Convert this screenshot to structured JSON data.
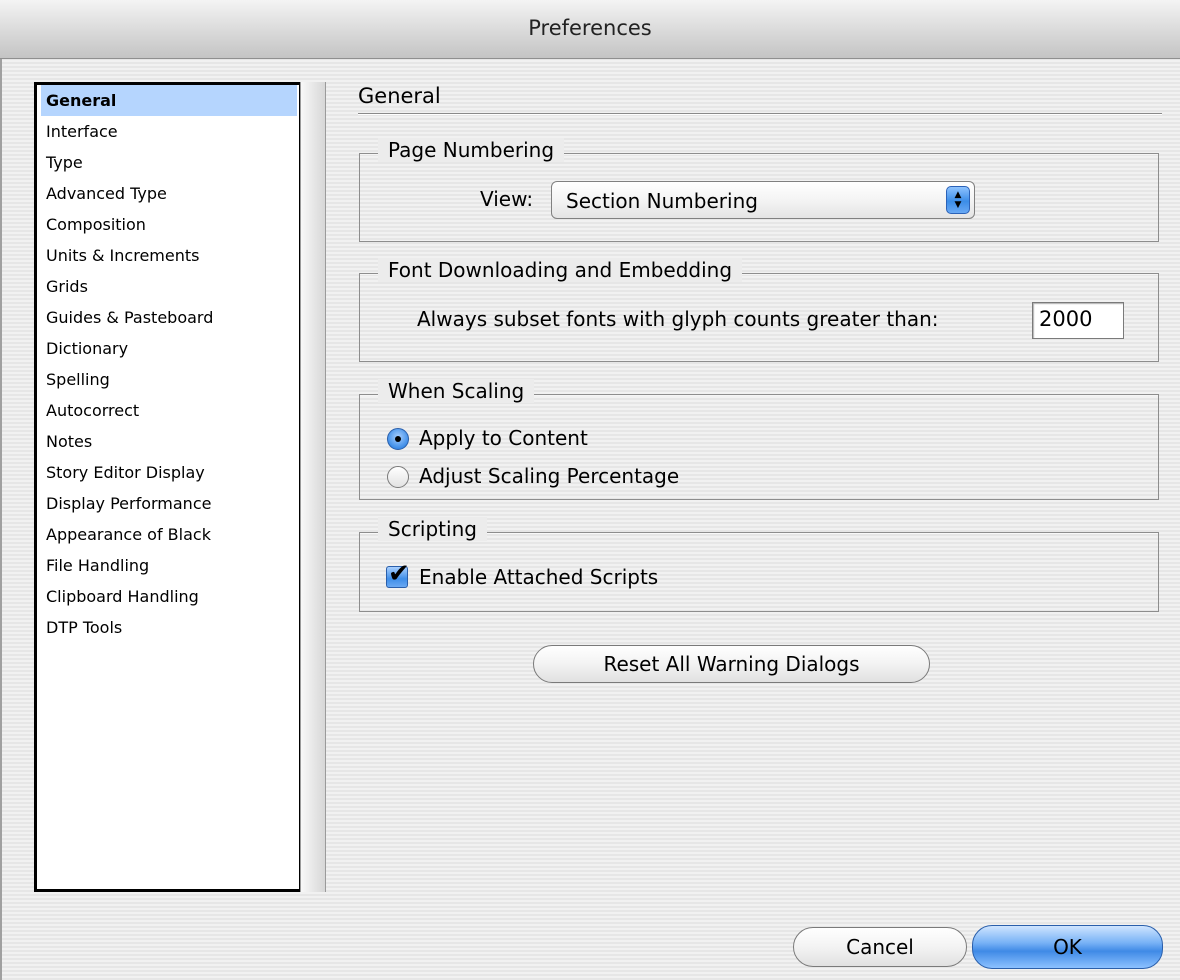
{
  "window": {
    "title": "Preferences"
  },
  "sidebar": {
    "items": [
      {
        "label": "General",
        "selected": true
      },
      {
        "label": "Interface"
      },
      {
        "label": "Type"
      },
      {
        "label": "Advanced Type"
      },
      {
        "label": "Composition"
      },
      {
        "label": "Units & Increments"
      },
      {
        "label": "Grids"
      },
      {
        "label": "Guides & Pasteboard"
      },
      {
        "label": "Dictionary"
      },
      {
        "label": "Spelling"
      },
      {
        "label": "Autocorrect"
      },
      {
        "label": "Notes"
      },
      {
        "label": "Story Editor Display"
      },
      {
        "label": "Display Performance"
      },
      {
        "label": "Appearance of Black"
      },
      {
        "label": "File Handling"
      },
      {
        "label": "Clipboard Handling"
      },
      {
        "label": "DTP Tools"
      }
    ]
  },
  "panel": {
    "title": "General",
    "page_numbering": {
      "label": "Page Numbering",
      "view_label": "View:",
      "view_value": "Section Numbering"
    },
    "font_downloading": {
      "label": "Font Downloading and Embedding",
      "subset_label": "Always subset fonts with glyph counts greater than:",
      "subset_value": "2000"
    },
    "when_scaling": {
      "label": "When Scaling",
      "options": [
        {
          "label": "Apply to Content",
          "selected": true
        },
        {
          "label": "Adjust Scaling Percentage",
          "selected": false
        }
      ]
    },
    "scripting": {
      "label": "Scripting",
      "enable_label": "Enable Attached Scripts",
      "enable_checked": true
    },
    "reset_label": "Reset All Warning Dialogs"
  },
  "footer": {
    "cancel_label": "Cancel",
    "ok_label": "OK"
  },
  "colors": {
    "selection": "#b5d5fe",
    "accent": "#3f8ee8"
  }
}
